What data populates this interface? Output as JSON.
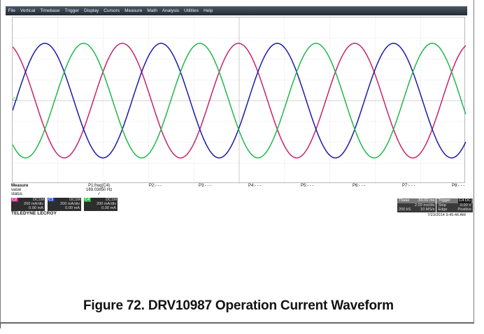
{
  "menu": [
    "File",
    "Vertical",
    "Timebase",
    "Trigger",
    "Display",
    "Cursors",
    "Measure",
    "Math",
    "Analysis",
    "Utilities",
    "Help"
  ],
  "markers": {
    "c4": "C4"
  },
  "colors": {
    "trace_magenta": "#c8226a",
    "trace_blue": "#1a1aa8",
    "trace_green": "#1fb84a",
    "grid": "#c0c0c0",
    "menubar": "#2e3844"
  },
  "measure": {
    "labels": {
      "measure": "Measure",
      "value": "value",
      "status": "status"
    },
    "params": [
      {
        "name": "P1:freq(C4)",
        "value": "169.03850 Hz"
      },
      {
        "name": "P2:- - -",
        "value": ""
      },
      {
        "name": "P3:- - -",
        "value": ""
      },
      {
        "name": "P4:- - -",
        "value": ""
      },
      {
        "name": "P5:- - -",
        "value": ""
      },
      {
        "name": "P6:- - -",
        "value": ""
      },
      {
        "name": "P7:- - -",
        "value": ""
      },
      {
        "name": "P8:- - -",
        "value": ""
      }
    ],
    "status_check": "✓"
  },
  "channels": [
    {
      "tag": "C2",
      "coupling": "DC1M",
      "scale": "200 mA/div",
      "offset": "0.00 mA",
      "color": "#d0207a"
    },
    {
      "tag": "C3",
      "coupling": "DC1M",
      "scale": "200 mA/div",
      "offset": "0.00 mA",
      "color": "#1b3fd0"
    },
    {
      "tag": "C4",
      "coupling": "DC1M",
      "scale": "200 mA/div",
      "offset": "0.00 mA",
      "color": "#17b83a"
    }
  ],
  "brand": "TELEDYNE LECROY",
  "timebase": {
    "label": "Tbase",
    "tbase_val": "-50.00 ms",
    "trigger_label": "Trigger",
    "trigger_badge": "C4 DC",
    "row2_left": "2.00 ms/div",
    "row2_right_label": "Stop",
    "row2_right_val": "0.00 V",
    "row3_left_a": "200 kS",
    "row3_left_b": "10 MS/s",
    "row3_right_label": "Edge",
    "row3_right_val": "Positive"
  },
  "timestamp": "7/23/2014 9:45:46 AM",
  "caption": "Figure 72. DRV10987 Operation Current Waveform",
  "trace_model": {
    "cycles_on_screen": 3.9,
    "phase_shift_deg": 120
  }
}
